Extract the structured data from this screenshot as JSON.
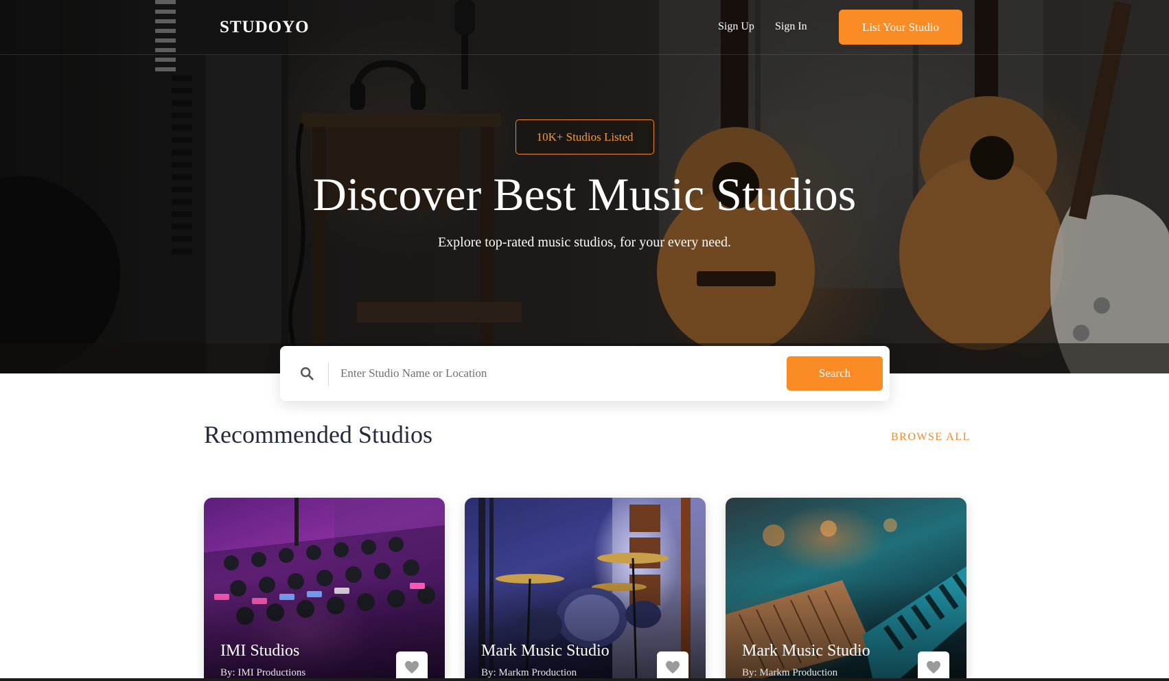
{
  "brand": {
    "name": "STUDOYO"
  },
  "nav": {
    "sign_up": "Sign Up",
    "sign_in": "Sign In",
    "list_studio": "List Your Studio"
  },
  "hero": {
    "badge": "10K+ Studios Listed",
    "title": "Discover Best Music Studios",
    "subtitle": "Explore top-rated music studios, for your every need."
  },
  "search": {
    "placeholder": "Enter Studio Name or Location",
    "value": "",
    "button": "Search",
    "icon": "search-icon"
  },
  "recommended": {
    "title": "Recommended Studios",
    "browse_all": "BROWSE ALL",
    "cards": [
      {
        "title": "IMI Studios",
        "owner": "By: IMI Productions",
        "icon": "heart-icon"
      },
      {
        "title": "Mark Music Studio",
        "owner": "By: Markm Production",
        "icon": "heart-icon"
      },
      {
        "title": "Mark Music Studio",
        "owner": "By: Markm Production",
        "icon": "heart-icon"
      }
    ]
  },
  "colors": {
    "accent": "#fb8c25",
    "heading": "#222b3d",
    "white": "#ffffff"
  }
}
